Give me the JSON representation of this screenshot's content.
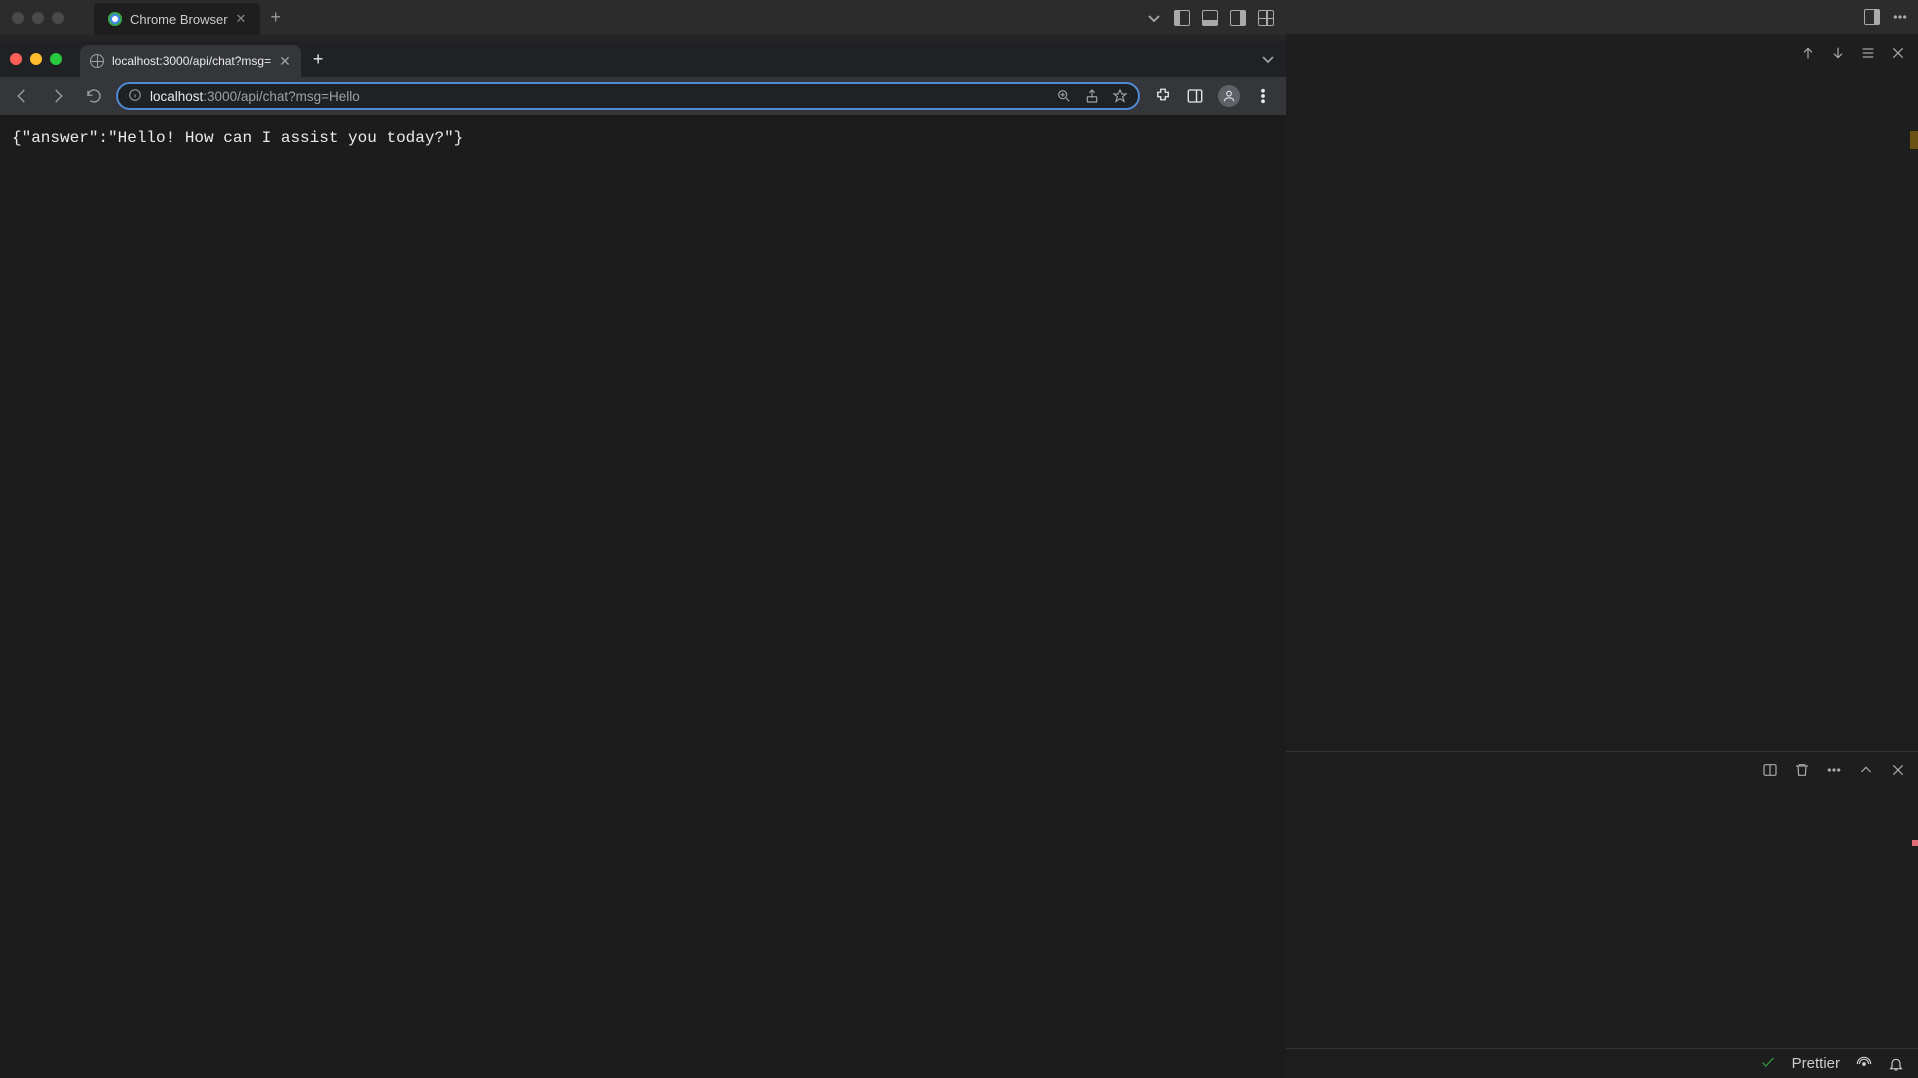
{
  "vscode": {
    "tab_title": "Chrome Browser",
    "layout_icons": [
      "panel-left",
      "panel-bottom",
      "panel-right",
      "panel-grid"
    ]
  },
  "chrome": {
    "tab_title": "localhost:3000/api/chat?msg=",
    "url_host": "localhost",
    "url_rest": ":3000/api/chat?msg=Hello",
    "content": "{\"answer\":\"Hello! How can I assist you today?\"}"
  },
  "right_panel": {
    "second_bar_icons": [
      "arrow-up",
      "arrow-down",
      "list",
      "close"
    ],
    "lower_bar_icons": [
      "panel",
      "trash",
      "more",
      "chevron-up",
      "close"
    ],
    "status": {
      "prettier_label": "Prettier"
    }
  }
}
